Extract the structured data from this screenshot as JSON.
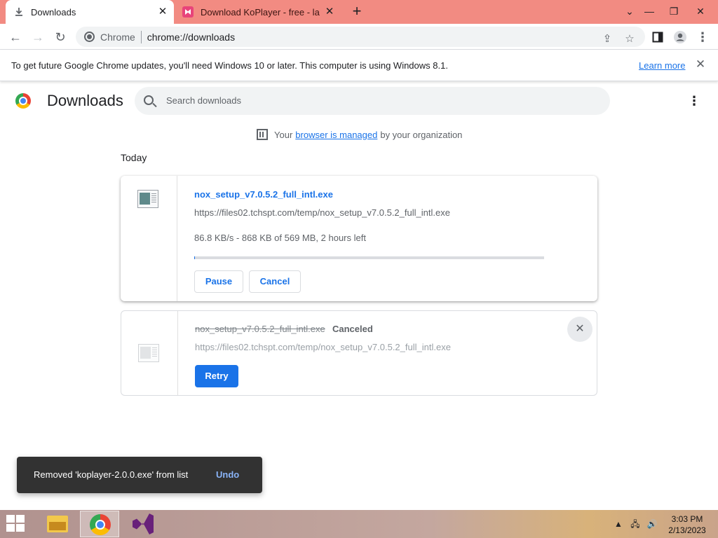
{
  "tabs": [
    {
      "title": "Downloads",
      "icon": "download-icon",
      "active": true
    },
    {
      "title": "Download KoPlayer - free - latest",
      "icon": "koplayer-favicon",
      "active": false
    }
  ],
  "toolbar": {
    "site_label": "Chrome",
    "url": "chrome://downloads"
  },
  "infobar": {
    "message": "To get future Google Chrome updates, you'll need Windows 10 or later. This computer is using Windows 8.1.",
    "link": "Learn more"
  },
  "header": {
    "title": "Downloads",
    "search_placeholder": "Search downloads"
  },
  "managed": {
    "prefix": "Your",
    "link": "browser is managed",
    "suffix": "by your organization"
  },
  "section": "Today",
  "downloads": [
    {
      "file_name": "nox_setup_v7.0.5.2_full_intl.exe",
      "url": "https://files02.tchspt.com/temp/nox_setup_v7.0.5.2_full_intl.exe",
      "progress_text": "86.8 KB/s - 868 KB of 569 MB, 2 hours left",
      "progress_fraction": 0.0015,
      "pause_label": "Pause",
      "cancel_label": "Cancel"
    },
    {
      "file_name": "nox_setup_v7.0.5.2_full_intl.exe",
      "status": "Canceled",
      "url": "https://files02.tchspt.com/temp/nox_setup_v7.0.5.2_full_intl.exe",
      "retry_label": "Retry"
    }
  ],
  "toast": {
    "message": "Removed 'koplayer-2.0.0.exe' from list",
    "action": "Undo"
  },
  "taskbar": {
    "time": "3:03 PM",
    "date": "2/13/2023"
  },
  "colors": {
    "accent": "#1a73e8",
    "tabstrip": "#f28b82",
    "toast_bg": "#323232"
  }
}
